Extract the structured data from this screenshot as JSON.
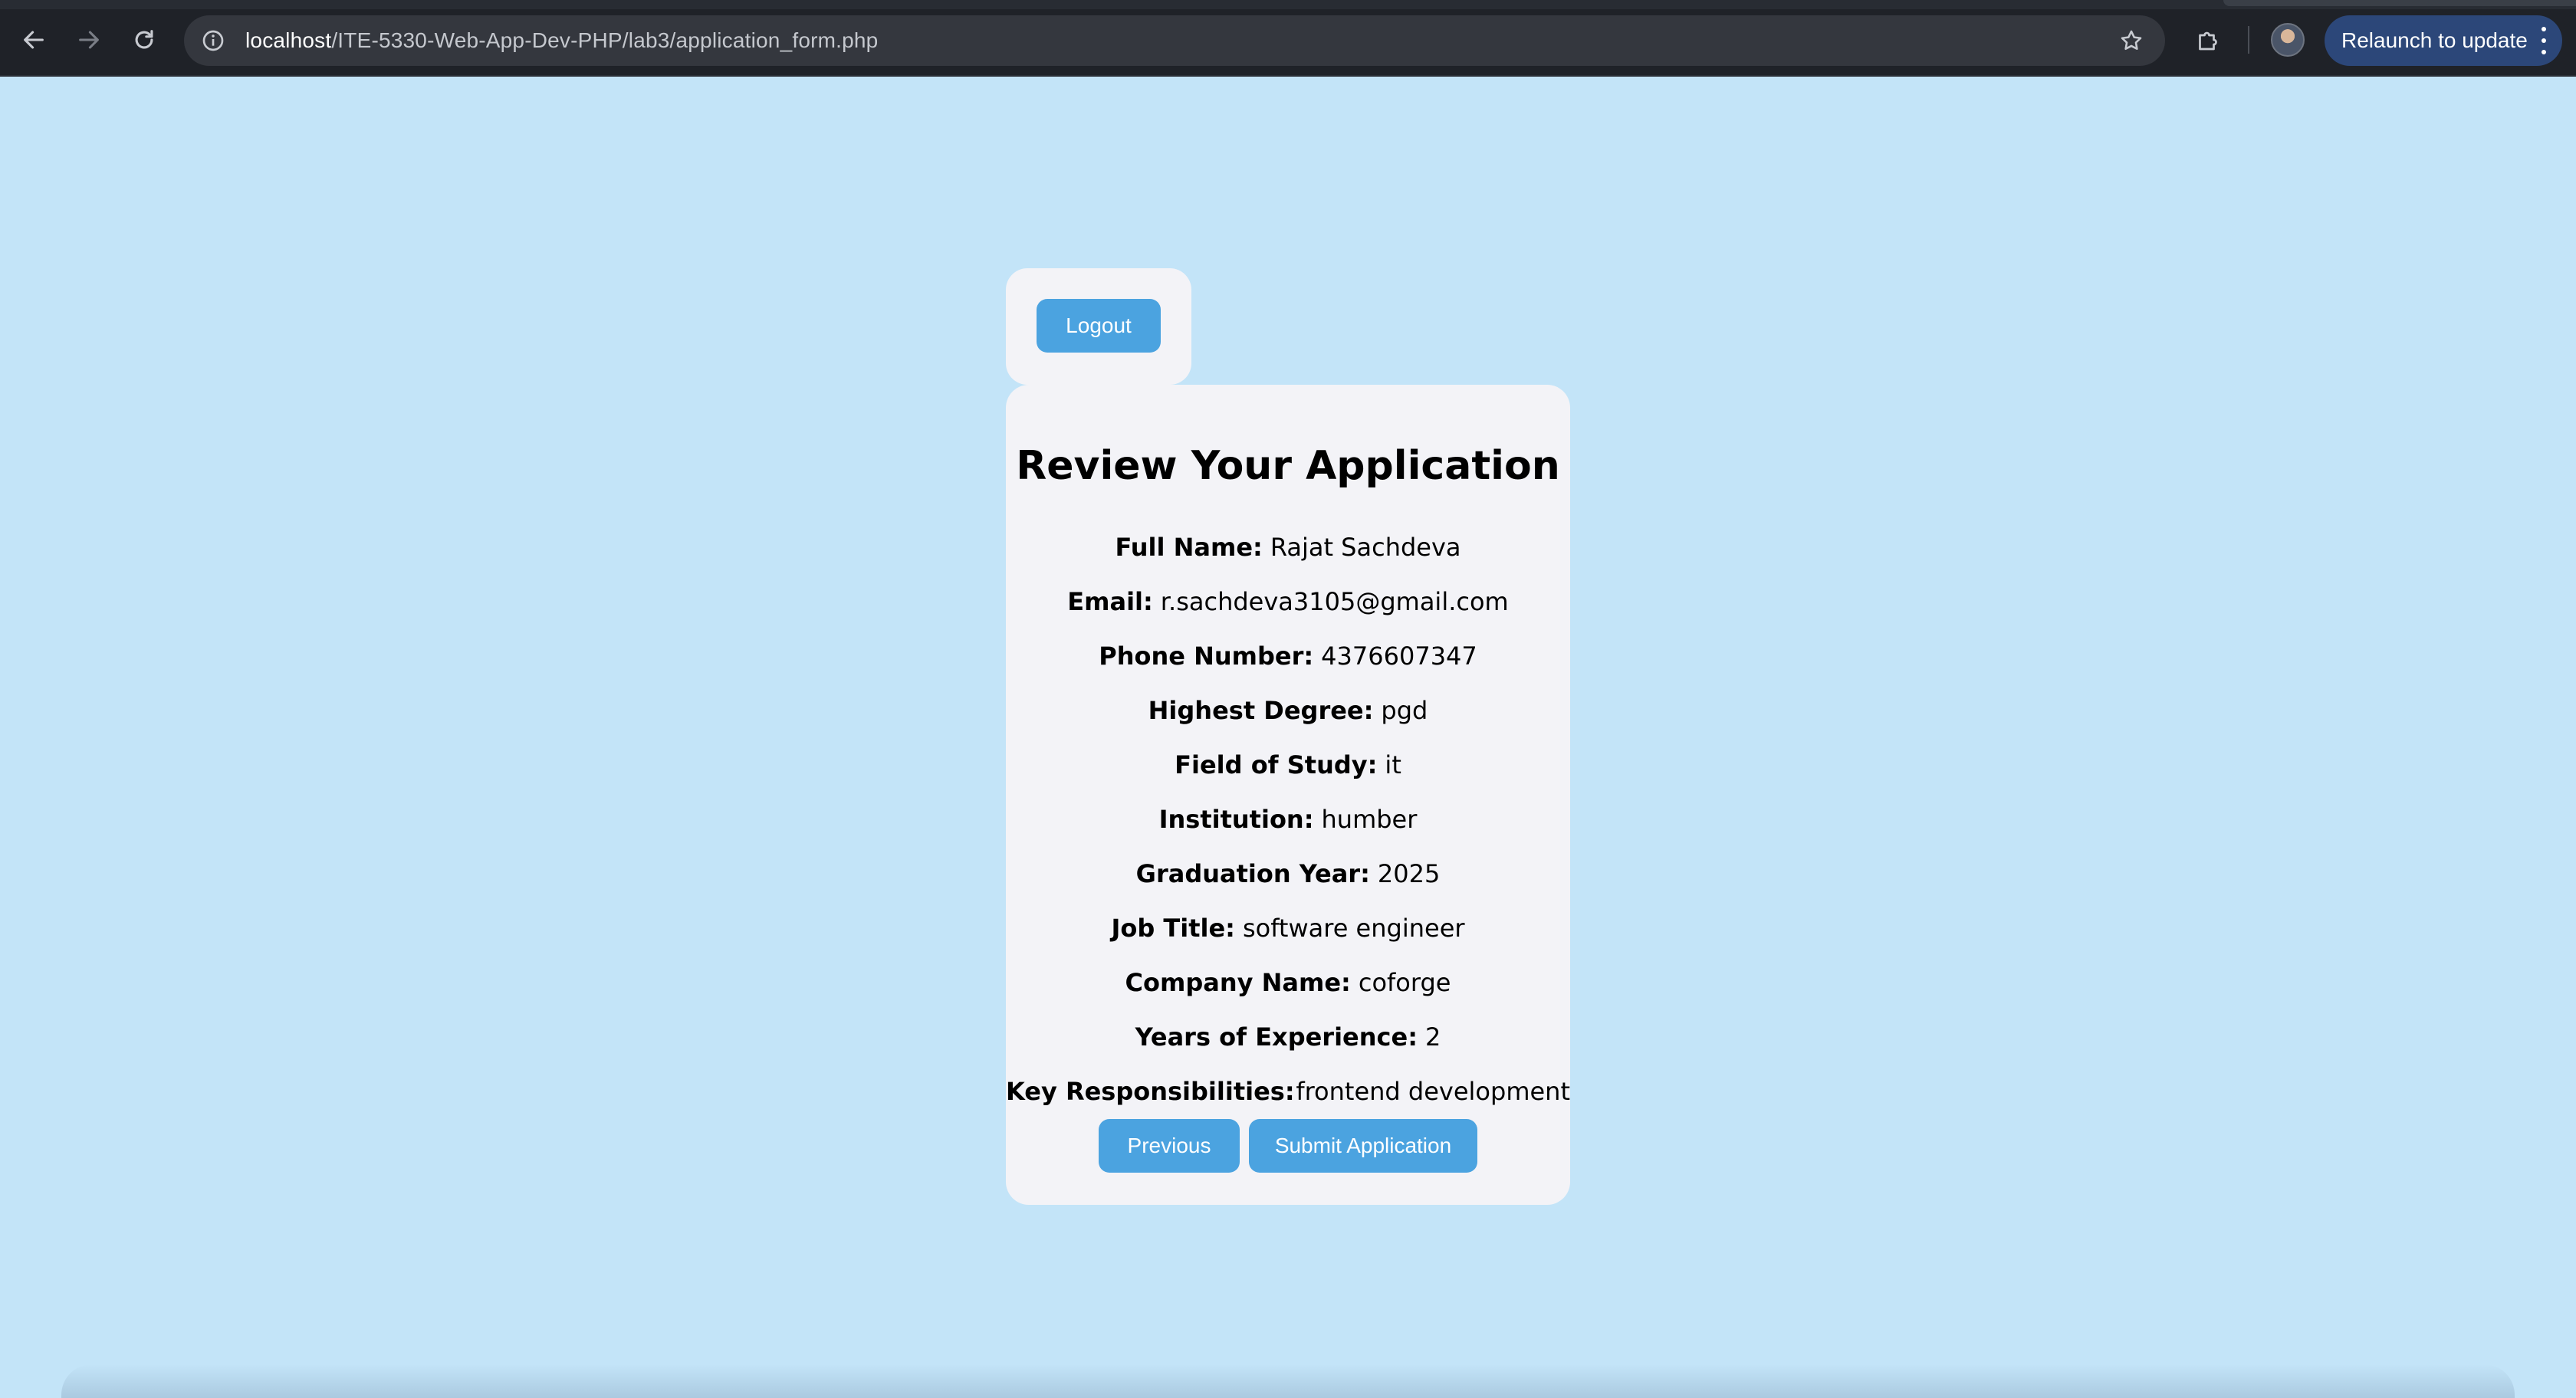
{
  "browser": {
    "url_host": "localhost",
    "url_path": "/ITE-5330-Web-App-Dev-PHP/lab3/application_form.php",
    "relaunch_label": "Relaunch to update",
    "icons": {
      "back": "back-arrow-icon",
      "forward": "forward-arrow-icon",
      "reload": "reload-icon",
      "site_info": "info-icon",
      "bookmark": "star-icon",
      "extensions": "puzzle-icon",
      "menu": "more-vert-icon"
    }
  },
  "page": {
    "logout_label": "Logout",
    "title": "Review Your Application",
    "fields": [
      {
        "label": "Full Name:",
        "value": "Rajat Sachdeva"
      },
      {
        "label": "Email:",
        "value": "r.sachdeva3105@gmail.com"
      },
      {
        "label": "Phone Number:",
        "value": "4376607347"
      },
      {
        "label": "Highest Degree:",
        "value": "pgd"
      },
      {
        "label": "Field of Study:",
        "value": "it"
      },
      {
        "label": "Institution:",
        "value": "humber"
      },
      {
        "label": "Graduation Year:",
        "value": "2025"
      },
      {
        "label": "Job Title:",
        "value": "software engineer"
      },
      {
        "label": "Company Name:",
        "value": "coforge"
      },
      {
        "label": "Years of Experience:",
        "value": "2"
      },
      {
        "label": "Key Responsibilities:",
        "value": "frontend development"
      }
    ],
    "previous_label": "Previous",
    "submit_label": "Submit Application"
  },
  "colors": {
    "page_background": "#c3e4f8",
    "card_background": "#f3f3f7",
    "button": "#4ba3e0",
    "chrome": "#1f2228",
    "relaunch_button": "#2c4779"
  }
}
